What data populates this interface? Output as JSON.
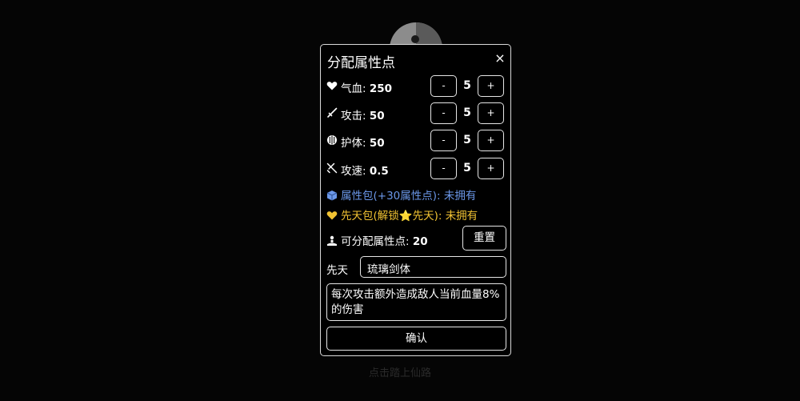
{
  "background": {
    "footer_text": "点击踏上仙路"
  },
  "modal": {
    "title": "分配属性点",
    "close_label": "×",
    "stats": [
      {
        "icon": "heart-icon",
        "label": "气血: ",
        "value": "250",
        "step": "5",
        "minus": "-",
        "plus": "+"
      },
      {
        "icon": "sword-icon",
        "label": "攻击: ",
        "value": "50",
        "step": "5",
        "minus": "-",
        "plus": "+"
      },
      {
        "icon": "shield-icon",
        "label": "护体: ",
        "value": "50",
        "step": "5",
        "minus": "-",
        "plus": "+"
      },
      {
        "icon": "crossed-swords-icon",
        "label": "攻速: ",
        "value": "0.5",
        "step": "5",
        "minus": "-",
        "plus": "+"
      }
    ],
    "attribute_pack": {
      "icon": "cube-icon",
      "label": "属性包(+30属性点): ",
      "status": "未拥有",
      "color": "#6b97e8"
    },
    "innate_pack": {
      "icon": "golden-heart-icon",
      "label": "先天包(解锁⭐先天): ",
      "status": "未拥有",
      "color": "#f1c232"
    },
    "points": {
      "icon": "person-icon",
      "label": "可分配属性点: ",
      "value": "20"
    },
    "reset_label": "重置",
    "innate": {
      "label": "先天",
      "value": "琉璃剑体"
    },
    "description": "每次攻击额外造成敌人当前血量8%的伤害",
    "confirm_label": "确认"
  }
}
